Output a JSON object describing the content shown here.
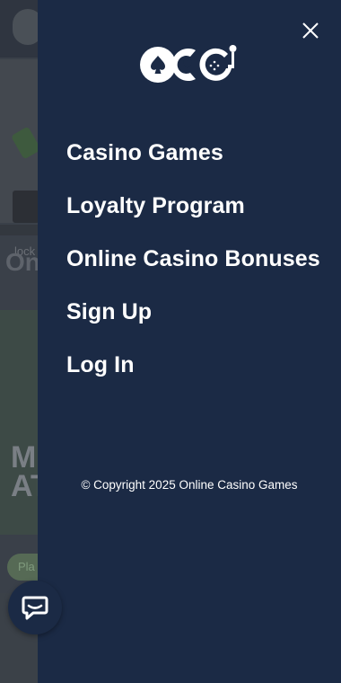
{
  "background_page": {
    "heading_fragment": "On",
    "banner_text_line1": "M",
    "banner_text_line2": "AT",
    "pill_text": "Pla",
    "card_text": "lock"
  },
  "drawer": {
    "logo_text": "OCG",
    "menu": [
      {
        "label": "Casino Games"
      },
      {
        "label": "Loyalty Program"
      },
      {
        "label": "Online Casino Bonuses"
      },
      {
        "label": "Sign Up"
      },
      {
        "label": "Log In"
      }
    ],
    "copyright": "© Copyright 2025 Online Casino Games"
  },
  "colors": {
    "drawer_bg": "#1b2a45",
    "text": "#ffffff",
    "overlay": "#3a4049"
  },
  "icons": {
    "close": "close-icon",
    "chat": "chat-bubble-icon",
    "logo": "ocg-logo"
  }
}
